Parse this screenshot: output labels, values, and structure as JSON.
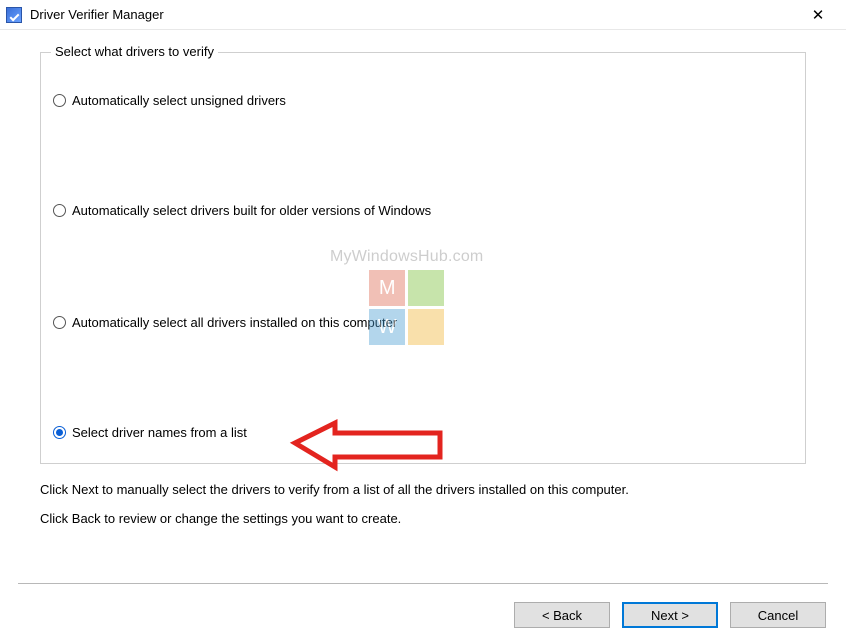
{
  "window": {
    "title": "Driver Verifier Manager"
  },
  "groupbox": {
    "legend": "Select what drivers to verify",
    "options": [
      {
        "label": "Automatically select unsigned drivers",
        "selected": false
      },
      {
        "label": "Automatically select drivers built for older versions of Windows",
        "selected": false
      },
      {
        "label": "Automatically select all drivers installed on this computer",
        "selected": false
      },
      {
        "label": "Select driver names from a list",
        "selected": true
      }
    ]
  },
  "help": {
    "line1": "Click Next to manually select the drivers to verify from a list of all the drivers installed on this computer.",
    "line2": "Click Back to review or change the settings you want to create."
  },
  "buttons": {
    "back": "< Back",
    "next": "Next >",
    "cancel": "Cancel"
  },
  "watermark": {
    "text": "MyWindowsHub.com",
    "letters": [
      "M",
      "",
      "W",
      ""
    ]
  }
}
